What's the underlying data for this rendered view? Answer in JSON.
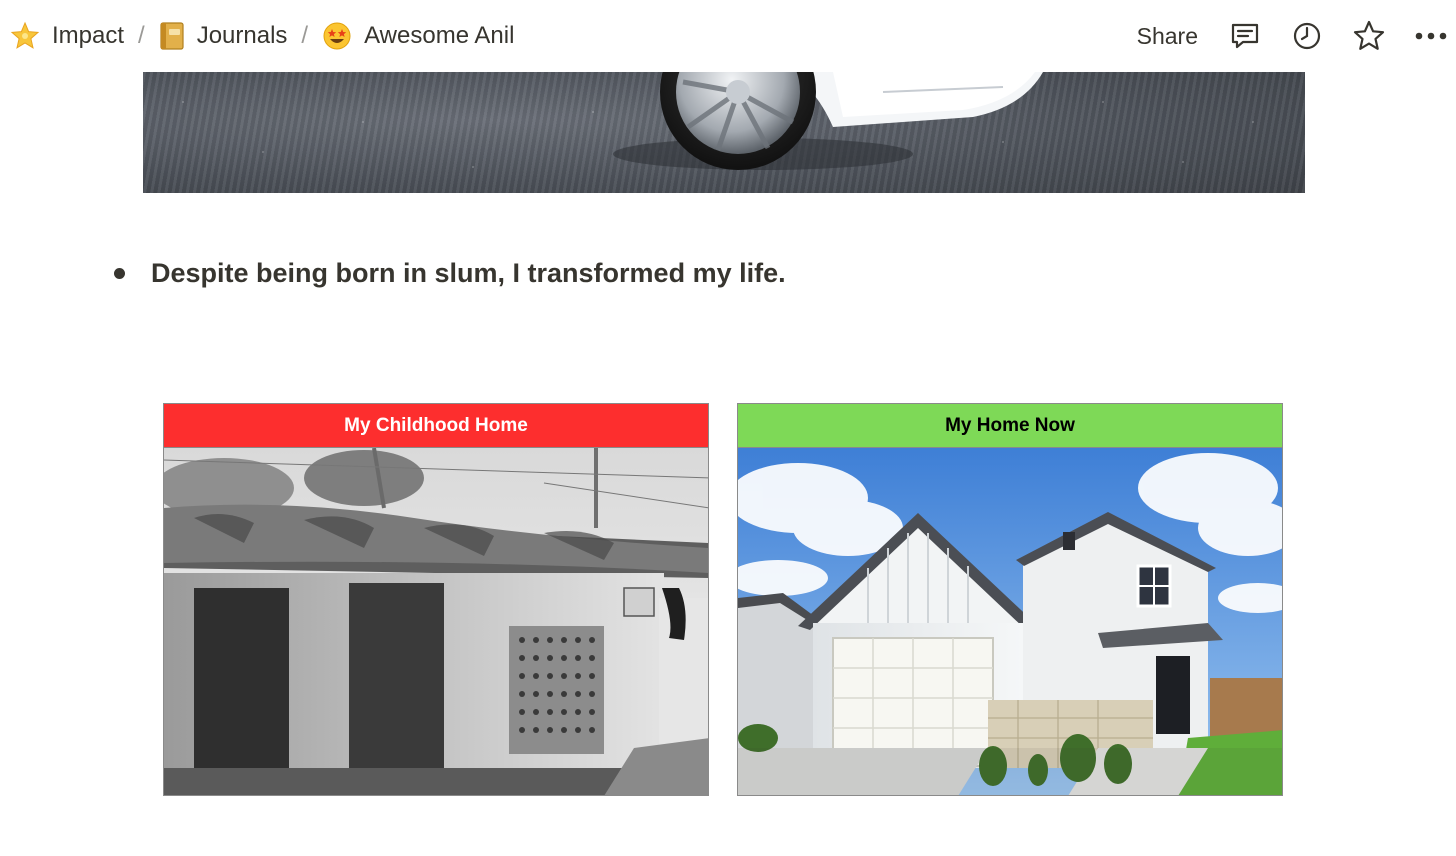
{
  "breadcrumb": {
    "items": [
      {
        "icon": "star-emoji-icon",
        "glyph": "🌟",
        "label": "Impact"
      },
      {
        "icon": "notebook-emoji-icon",
        "glyph": "📔",
        "label": "Journals"
      },
      {
        "icon": "star-struck-emoji-icon",
        "glyph": "🤩",
        "label": "Awesome Anil"
      }
    ],
    "separator": "/"
  },
  "toolbar": {
    "share_label": "Share",
    "icons": [
      "comment-icon",
      "clock-icon",
      "star-outline-icon",
      "more-icon"
    ]
  },
  "content": {
    "bullet_text": "Despite being born in slum, I transformed my life."
  },
  "comparison": {
    "left": {
      "title": "My Childhood Home",
      "header_color": "#fd2e2e",
      "title_color": "#ffffff"
    },
    "right": {
      "title": "My Home Now",
      "header_color": "#7ed957",
      "title_color": "#000000"
    }
  }
}
